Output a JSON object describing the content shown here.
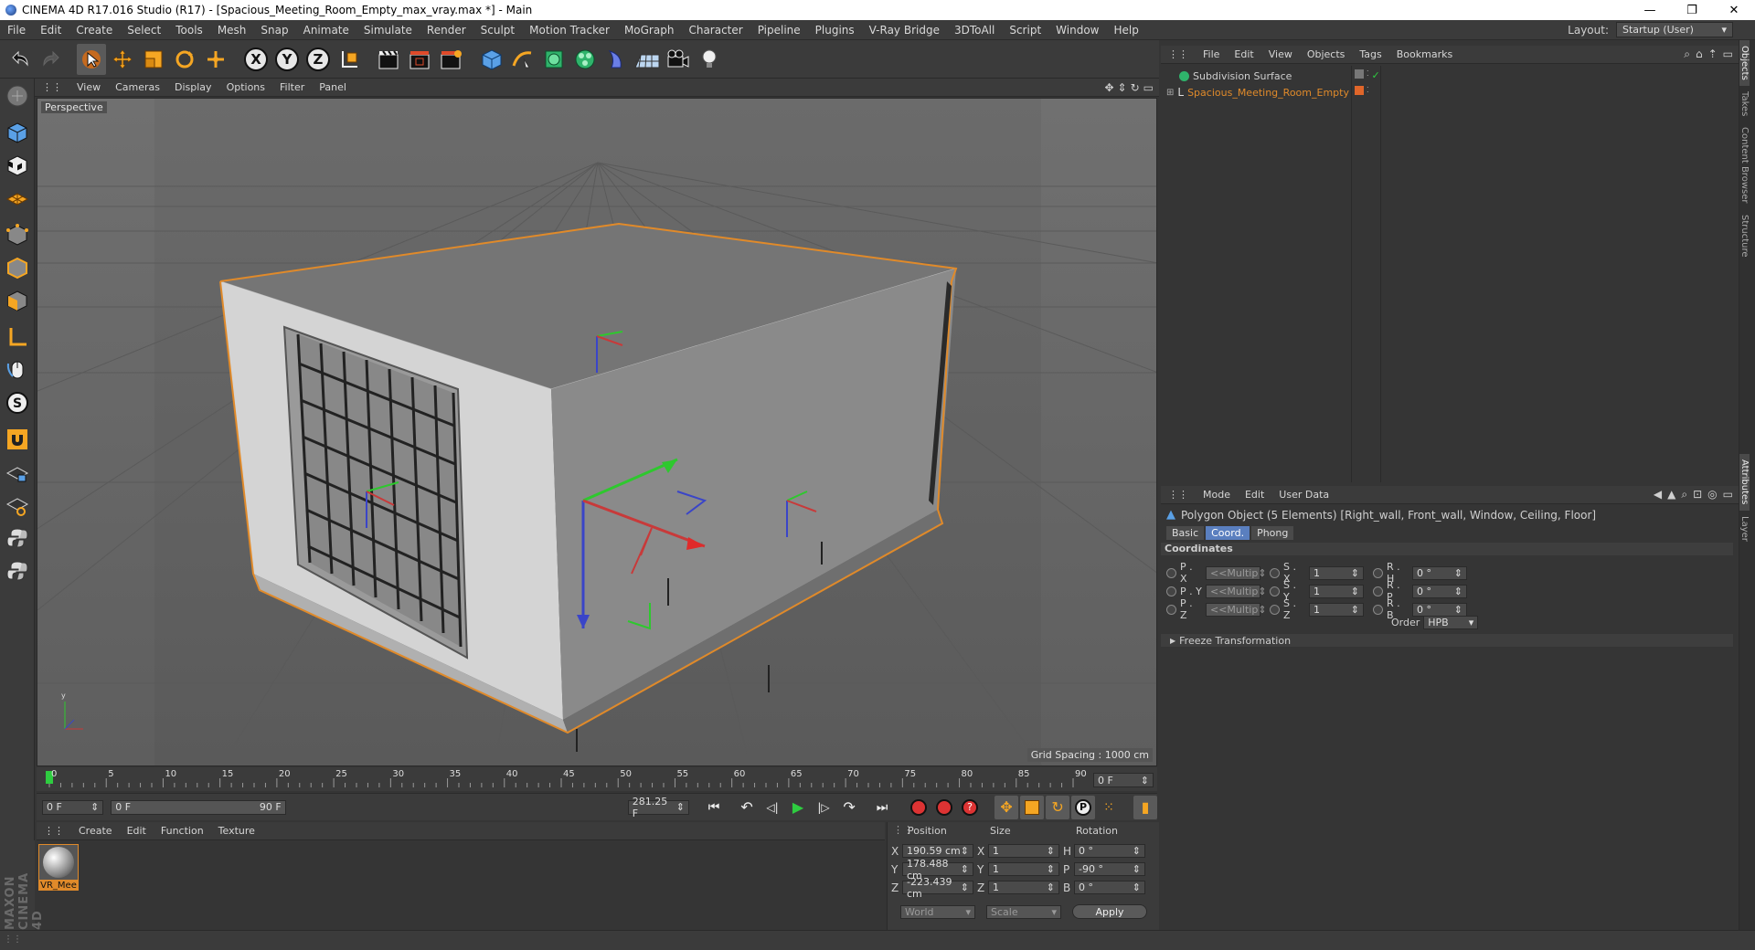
{
  "window": {
    "title": "CINEMA 4D R17.016 Studio (R17) - [Spacious_Meeting_Room_Empty_max_vray.max *] - Main",
    "min": "—",
    "max": "❐",
    "close": "✕"
  },
  "menubar": {
    "items": [
      "File",
      "Edit",
      "Create",
      "Select",
      "Tools",
      "Mesh",
      "Snap",
      "Animate",
      "Simulate",
      "Render",
      "Sculpt",
      "Motion Tracker",
      "MoGraph",
      "Character",
      "Pipeline",
      "Plugins",
      "V-Ray Bridge",
      "3DToAll",
      "Script",
      "Window",
      "Help"
    ],
    "layout_label": "Layout:",
    "layout_value": "Startup (User)"
  },
  "viewport": {
    "menu": [
      "View",
      "Cameras",
      "Display",
      "Options",
      "Filter",
      "Panel"
    ],
    "label": "Perspective",
    "grid_spacing": "Grid Spacing : 1000 cm"
  },
  "timeline": {
    "ticks": [
      "0",
      "5",
      "10",
      "15",
      "20",
      "25",
      "30",
      "35",
      "40",
      "45",
      "50",
      "55",
      "60",
      "65",
      "70",
      "75",
      "80",
      "85",
      "90"
    ],
    "current_frame": "0 F",
    "start": "0 F",
    "range_start": "0 F",
    "range_end": "90 F",
    "fps_field": "281.25 F"
  },
  "materials": {
    "menu": [
      "Create",
      "Edit",
      "Function",
      "Texture"
    ],
    "items": [
      {
        "name": "VR_Mee"
      }
    ]
  },
  "coords": {
    "headers": [
      "Position",
      "Size",
      "Rotation"
    ],
    "rows": [
      {
        "axis": "X",
        "pos": "190.59 cm",
        "saxis": "X",
        "size": "1",
        "raxis": "H",
        "rot": "0 °"
      },
      {
        "axis": "Y",
        "pos": "178.488 cm",
        "saxis": "Y",
        "size": "1",
        "raxis": "P",
        "rot": "-90 °"
      },
      {
        "axis": "Z",
        "pos": "-223.439 cm",
        "saxis": "Z",
        "size": "1",
        "raxis": "B",
        "rot": "0 °"
      }
    ],
    "world": "World",
    "scale": "Scale",
    "apply": "Apply"
  },
  "objects": {
    "menu": [
      "File",
      "Edit",
      "View",
      "Objects",
      "Tags",
      "Bookmarks"
    ],
    "items": [
      {
        "name": "Subdivision Surface",
        "color": "#cfcfcf"
      },
      {
        "name": "Spacious_Meeting_Room_Empty",
        "color": "#e08a2a"
      }
    ]
  },
  "sidetabs": [
    "Objects",
    "Takes",
    "Content Browser",
    "Structure",
    "Attributes",
    "Layer"
  ],
  "attributes": {
    "menu": [
      "Mode",
      "Edit",
      "User Data"
    ],
    "object_title": "Polygon Object (5 Elements) [Right_wall, Front_wall, Window, Ceiling, Floor]",
    "tabs": [
      "Basic",
      "Coord.",
      "Phong"
    ],
    "active_tab": "Coord.",
    "section": "Coordinates",
    "px_label": "P . X",
    "py_label": "P . Y",
    "pz_label": "P . Z",
    "sx_label": "S . X",
    "sy_label": "S . Y",
    "sz_label": "S . Z",
    "rh_label": "R . H",
    "rp_label": "R . P",
    "rb_label": "R . B",
    "multi": "<<Multip",
    "s_value": "1",
    "r_value": "0 °",
    "order_label": "Order",
    "order_value": "HPB",
    "freeze": "Freeze Transformation"
  },
  "brand": {
    "text": "MAXON CINEMA 4D"
  },
  "colors": {
    "accent": "#5a7fbf",
    "selection": "#e08a2a"
  }
}
